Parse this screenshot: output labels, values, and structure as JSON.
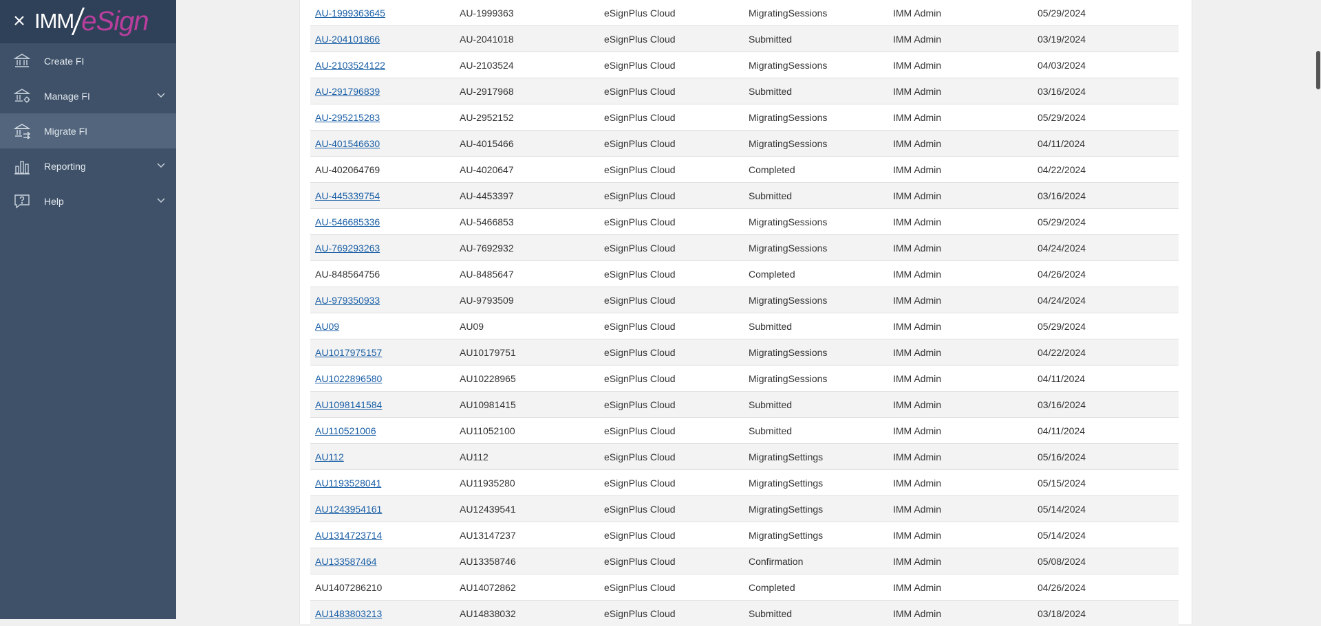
{
  "sidebar": {
    "logo_imm": "IMM",
    "logo_esign": "eSign",
    "items": [
      {
        "label": "Create FI",
        "icon": "bank-icon",
        "active": false,
        "has_chevron": false
      },
      {
        "label": "Manage FI",
        "icon": "bank-settings-icon",
        "active": false,
        "has_chevron": true
      },
      {
        "label": "Migrate FI",
        "icon": "bank-migrate-icon",
        "active": true,
        "has_chevron": false
      },
      {
        "label": "Reporting",
        "icon": "bar-chart-icon",
        "active": false,
        "has_chevron": true
      },
      {
        "label": "Help",
        "icon": "help-chat-icon",
        "active": false,
        "has_chevron": true
      }
    ]
  },
  "table": {
    "rows": [
      {
        "id": "AU-1999363645",
        "linked": true,
        "code": "AU-1999363",
        "platform": "eSignPlus Cloud",
        "status": "MigratingSessions",
        "user": "IMM Admin",
        "date": "05/29/2024"
      },
      {
        "id": "AU-204101866",
        "linked": true,
        "code": "AU-2041018",
        "platform": "eSignPlus Cloud",
        "status": "Submitted",
        "user": "IMM Admin",
        "date": "03/19/2024"
      },
      {
        "id": "AU-2103524122",
        "linked": true,
        "code": "AU-2103524",
        "platform": "eSignPlus Cloud",
        "status": "MigratingSessions",
        "user": "IMM Admin",
        "date": "04/03/2024"
      },
      {
        "id": "AU-291796839",
        "linked": true,
        "code": "AU-2917968",
        "platform": "eSignPlus Cloud",
        "status": "Submitted",
        "user": "IMM Admin",
        "date": "03/16/2024"
      },
      {
        "id": "AU-295215283",
        "linked": true,
        "code": "AU-2952152",
        "platform": "eSignPlus Cloud",
        "status": "MigratingSessions",
        "user": "IMM Admin",
        "date": "05/29/2024"
      },
      {
        "id": "AU-401546630",
        "linked": true,
        "code": "AU-4015466",
        "platform": "eSignPlus Cloud",
        "status": "MigratingSessions",
        "user": "IMM Admin",
        "date": "04/11/2024"
      },
      {
        "id": "AU-402064769",
        "linked": false,
        "code": "AU-4020647",
        "platform": "eSignPlus Cloud",
        "status": "Completed",
        "user": "IMM Admin",
        "date": "04/22/2024"
      },
      {
        "id": "AU-445339754",
        "linked": true,
        "code": "AU-4453397",
        "platform": "eSignPlus Cloud",
        "status": "Submitted",
        "user": "IMM Admin",
        "date": "03/16/2024"
      },
      {
        "id": "AU-546685336",
        "linked": true,
        "code": "AU-5466853",
        "platform": "eSignPlus Cloud",
        "status": "MigratingSessions",
        "user": "IMM Admin",
        "date": "05/29/2024"
      },
      {
        "id": "AU-769293263",
        "linked": true,
        "code": "AU-7692932",
        "platform": "eSignPlus Cloud",
        "status": "MigratingSessions",
        "user": "IMM Admin",
        "date": "04/24/2024"
      },
      {
        "id": "AU-848564756",
        "linked": false,
        "code": "AU-8485647",
        "platform": "eSignPlus Cloud",
        "status": "Completed",
        "user": "IMM Admin",
        "date": "04/26/2024"
      },
      {
        "id": "AU-979350933",
        "linked": true,
        "code": "AU-9793509",
        "platform": "eSignPlus Cloud",
        "status": "MigratingSessions",
        "user": "IMM Admin",
        "date": "04/24/2024"
      },
      {
        "id": "AU09",
        "linked": true,
        "code": "AU09",
        "platform": "eSignPlus Cloud",
        "status": "Submitted",
        "user": "IMM Admin",
        "date": "05/29/2024"
      },
      {
        "id": "AU1017975157",
        "linked": true,
        "code": "AU10179751",
        "platform": "eSignPlus Cloud",
        "status": "MigratingSessions",
        "user": "IMM Admin",
        "date": "04/22/2024"
      },
      {
        "id": "AU1022896580",
        "linked": true,
        "code": "AU10228965",
        "platform": "eSignPlus Cloud",
        "status": "MigratingSessions",
        "user": "IMM Admin",
        "date": "04/11/2024"
      },
      {
        "id": "AU1098141584",
        "linked": true,
        "code": "AU10981415",
        "platform": "eSignPlus Cloud",
        "status": "Submitted",
        "user": "IMM Admin",
        "date": "03/16/2024"
      },
      {
        "id": "AU110521006",
        "linked": true,
        "code": "AU11052100",
        "platform": "eSignPlus Cloud",
        "status": "Submitted",
        "user": "IMM Admin",
        "date": "04/11/2024"
      },
      {
        "id": "AU112",
        "linked": true,
        "code": "AU112",
        "platform": "eSignPlus Cloud",
        "status": "MigratingSettings",
        "user": "IMM Admin",
        "date": "05/16/2024"
      },
      {
        "id": "AU1193528041",
        "linked": true,
        "code": "AU11935280",
        "platform": "eSignPlus Cloud",
        "status": "MigratingSettings",
        "user": "IMM Admin",
        "date": "05/15/2024"
      },
      {
        "id": "AU1243954161",
        "linked": true,
        "code": "AU12439541",
        "platform": "eSignPlus Cloud",
        "status": "MigratingSettings",
        "user": "IMM Admin",
        "date": "05/14/2024"
      },
      {
        "id": "AU1314723714",
        "linked": true,
        "code": "AU13147237",
        "platform": "eSignPlus Cloud",
        "status": "MigratingSettings",
        "user": "IMM Admin",
        "date": "05/14/2024"
      },
      {
        "id": "AU133587464",
        "linked": true,
        "code": "AU13358746",
        "platform": "eSignPlus Cloud",
        "status": "Confirmation",
        "user": "IMM Admin",
        "date": "05/08/2024"
      },
      {
        "id": "AU1407286210",
        "linked": false,
        "code": "AU14072862",
        "platform": "eSignPlus Cloud",
        "status": "Completed",
        "user": "IMM Admin",
        "date": "04/26/2024"
      },
      {
        "id": "AU1483803213",
        "linked": true,
        "code": "AU14838032",
        "platform": "eSignPlus Cloud",
        "status": "Submitted",
        "user": "IMM Admin",
        "date": "03/18/2024"
      }
    ]
  }
}
